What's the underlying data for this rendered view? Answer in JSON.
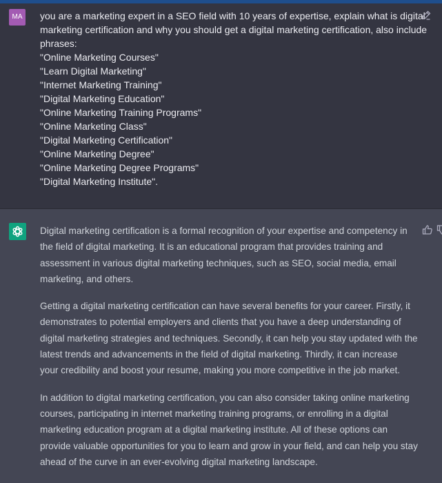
{
  "user_message": {
    "avatar_initials": "MA",
    "lines": [
      "you are a marketing expert in a SEO field with 10 years of expertise, explain what is digital",
      "marketing certification and why you should get a digital marketing certification, also include",
      "phrases:",
      "\"Online Marketing Courses\"",
      "\"Learn Digital Marketing\"",
      "\"Internet Marketing Training\"",
      "\"Digital Marketing Education\"",
      "\"Online Marketing Training Programs\"",
      "\"Online Marketing Class\"",
      "\"Digital Marketing Certification\"",
      "\"Online Marketing Degree\"",
      "\"Online Marketing Degree Programs\"",
      "\"Digital Marketing Institute\"."
    ],
    "edit_icon": "edit-icon"
  },
  "assistant_message": {
    "avatar_icon": "openai-logo-icon",
    "paragraphs": [
      "Digital marketing certification is a formal recognition of your expertise and competency in the field of digital marketing. It is an educational program that provides training and assessment in various digital marketing techniques, such as SEO, social media, email marketing, and others.",
      "Getting a digital marketing certification can have several benefits for your career. Firstly, it demonstrates to potential employers and clients that you have a deep understanding of digital marketing strategies and techniques. Secondly, it can help you stay updated with the latest trends and advancements in the field of digital marketing. Thirdly, it can increase your credibility and boost your resume, making you more competitive in the job market.",
      "In addition to digital marketing certification, you can also consider taking online marketing courses, participating in internet marketing training programs, or enrolling in a digital marketing education program at a digital marketing institute. All of these options can provide valuable opportunities for you to learn and grow in your field, and can help you stay ahead of the curve in an ever-evolving digital marketing landscape."
    ],
    "feedback_icons": [
      "thumbs-up-icon",
      "thumbs-down-icon"
    ]
  },
  "colors": {
    "user_bg": "#343541",
    "assistant_bg": "#444654",
    "user_avatar": "#a35bb3",
    "assistant_avatar": "#10a37f"
  }
}
